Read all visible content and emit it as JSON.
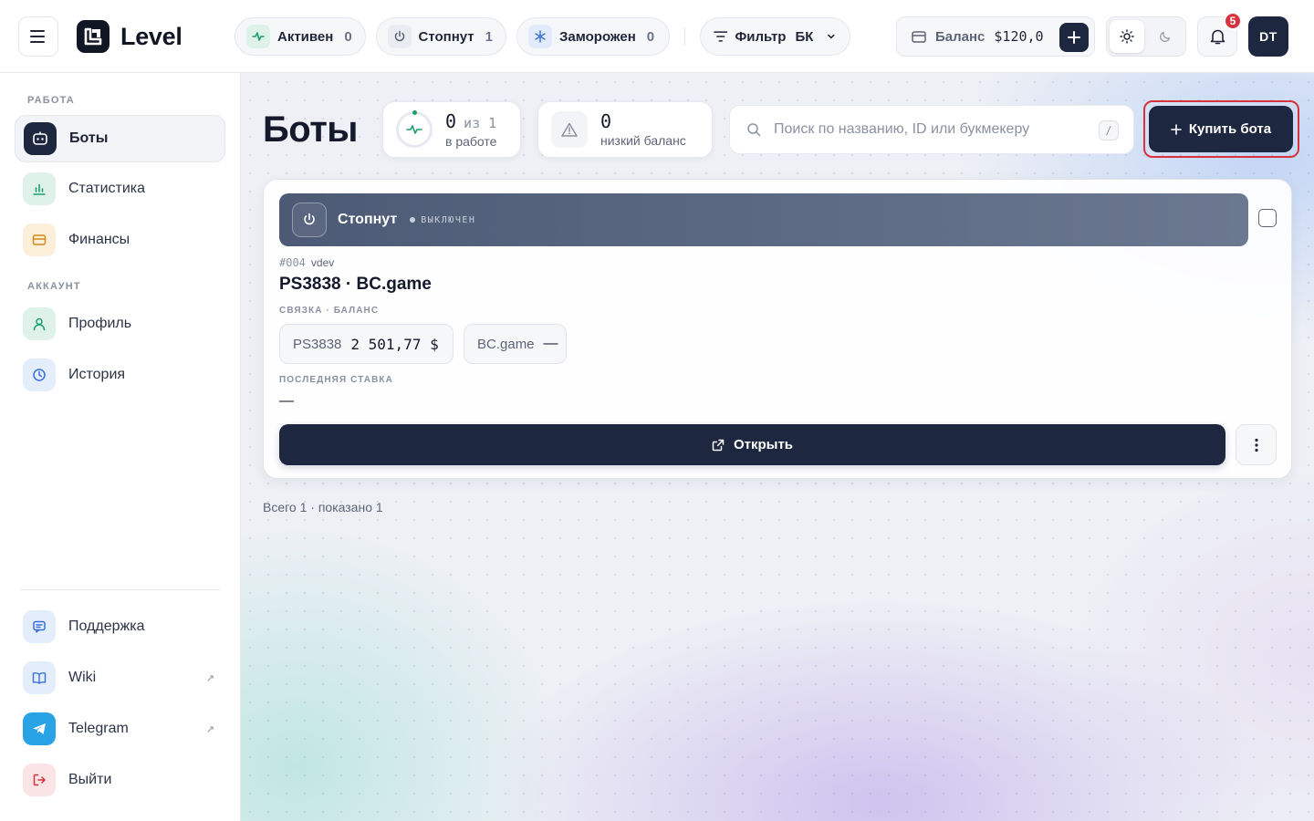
{
  "brand": {
    "name": "Level"
  },
  "topbar": {
    "chips": {
      "active": {
        "label": "Активен",
        "count": "0"
      },
      "stopped": {
        "label": "Стопнут",
        "count": "1"
      },
      "frozen": {
        "label": "Заморожен",
        "count": "0"
      },
      "filter": {
        "label": "Фильтр",
        "value": "БК"
      }
    },
    "balance": {
      "label": "Баланс",
      "amount": "$120,0"
    },
    "notifications": {
      "count": "5"
    },
    "avatar": {
      "initials": "DT"
    }
  },
  "sidebar": {
    "sections": [
      {
        "label": "РАБОТА"
      },
      {
        "label": "АККАУНТ"
      }
    ],
    "items": [
      {
        "label": "Боты",
        "icon": "bot-icon",
        "active": true
      },
      {
        "label": "Статистика",
        "icon": "chart-icon"
      },
      {
        "label": "Финансы",
        "icon": "wallet-icon"
      },
      {
        "label": "Профиль",
        "icon": "user-icon"
      },
      {
        "label": "История",
        "icon": "clock-icon"
      }
    ],
    "bottom": [
      {
        "label": "Поддержка",
        "icon": "chat-icon"
      },
      {
        "label": "Wiki",
        "icon": "book-icon",
        "external": true
      },
      {
        "label": "Telegram",
        "icon": "telegram-icon",
        "external": true
      },
      {
        "label": "Выйти",
        "icon": "logout-icon"
      }
    ],
    "external_glyph": "↗"
  },
  "main": {
    "title": "Боты",
    "stats": {
      "work": {
        "value": "0",
        "of": "из 1",
        "label": "в работе"
      },
      "low": {
        "value": "0",
        "label": "низкий баланс"
      }
    },
    "search": {
      "placeholder": "Поиск по названию, ID или букмекеру",
      "shortcut": "/"
    },
    "buy_label": "Купить бота",
    "bot": {
      "status": "Стопнут",
      "status_sub": "ВЫКЛЮЧЕН",
      "id": "#004",
      "user": "vdev",
      "name": "PS3838 · BC.game",
      "link_caption": "СВЯЗКА · БАЛАНС",
      "pairs": [
        {
          "book": "PS3838",
          "balance": "2 501,77 $"
        },
        {
          "book": "BC.game",
          "balance": "—"
        }
      ],
      "last_bet_caption": "ПОСЛЕДНЯЯ СТАВКА",
      "last_bet": "—",
      "open_label": "Открыть"
    },
    "footer": "Всего 1 · показано 1"
  },
  "colors": {
    "accent": "#1e2740",
    "danger": "#d6333f",
    "success": "#1f9d6b"
  }
}
